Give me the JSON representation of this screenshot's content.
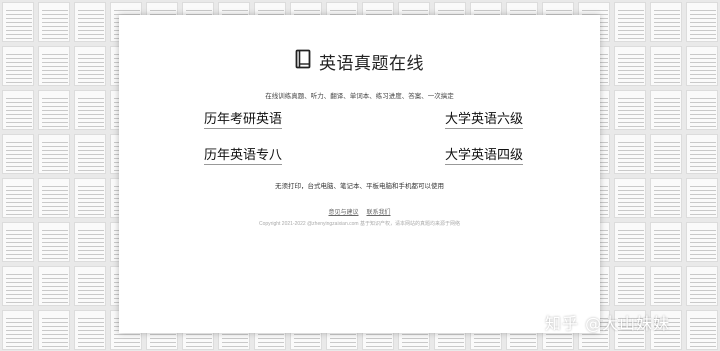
{
  "header": {
    "title": "英语真题在线",
    "icon": "book-icon",
    "subtitle": "在线训练真题、听力、翻译、单词本、练习进度、答案、一次搞定"
  },
  "links": [
    {
      "label": "历年考研英语"
    },
    {
      "label": "大学英语六级"
    },
    {
      "label": "历年英语专八"
    },
    {
      "label": "大学英语四级"
    }
  ],
  "description": "无须打印，台式电脑、笔记本、平板电脑和手机都可以使用",
  "footer": {
    "links": [
      "意见与建议",
      "联系我们"
    ],
    "copyright": "Copyright 2021-2022 @zhenyingzaixian.com  基于知识产权，请本网站的真题均来源于网络"
  },
  "watermark": "知乎 @大山妹妹",
  "colors": {
    "card_bg": "#ffffff",
    "page_bg": "#e9e9e9"
  }
}
